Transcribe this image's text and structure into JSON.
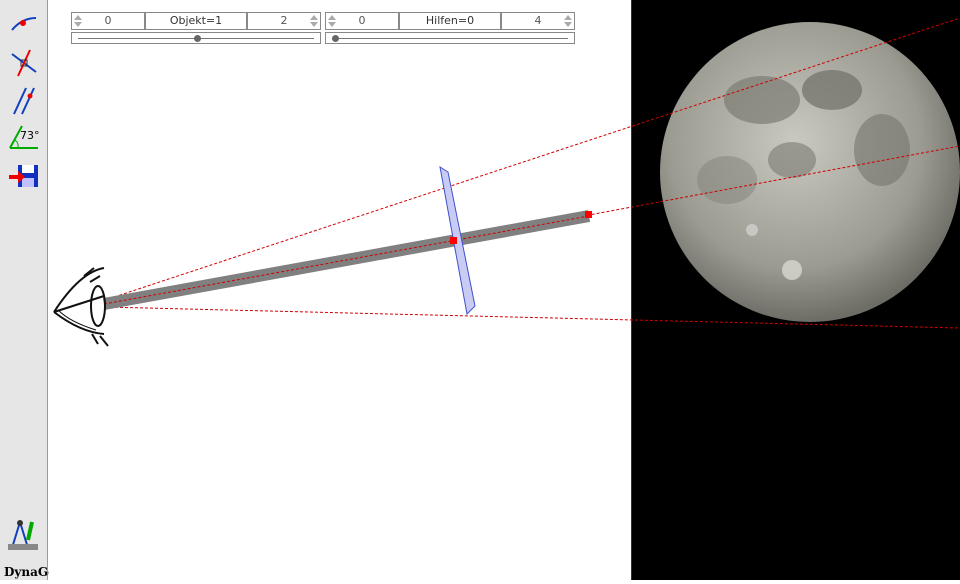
{
  "app": {
    "logo_text": "DynaGeo"
  },
  "controls": {
    "objekt": {
      "min": "0",
      "label": "Objekt=1",
      "max": "2",
      "value": 1,
      "min_value": 0,
      "max_value": 2
    },
    "hilfen": {
      "min": "0",
      "label": "Hilfen=0",
      "max": "4",
      "value": 0,
      "min_value": 0,
      "max_value": 4
    }
  },
  "toolbar": {
    "angle_label": "73°"
  },
  "icons": [
    "point-on-curve-icon",
    "perpendicular-icon",
    "parallel-icon",
    "angle-icon",
    "save-icon",
    "compass-tool-icon"
  ],
  "colors": {
    "ray": "#d00000",
    "rod": "#808080",
    "lens": "#c8ccf4",
    "lens_border": "#4050c8",
    "marker": "#ff0000"
  }
}
